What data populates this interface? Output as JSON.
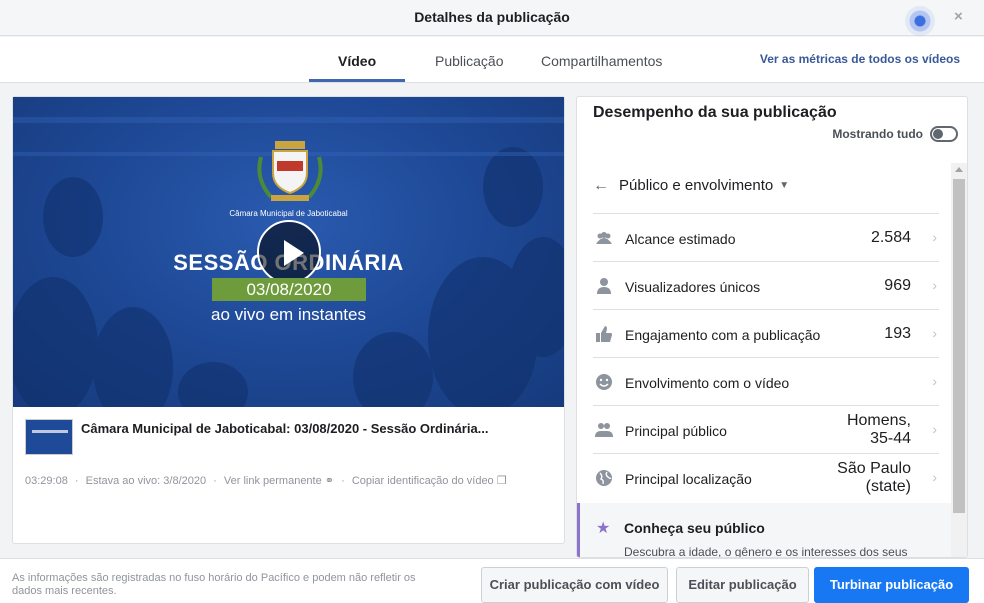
{
  "dialog": {
    "title": "Detalhes da publicação",
    "close_symbol": "×"
  },
  "tabs": [
    {
      "label": "Vídeo",
      "active": true
    },
    {
      "label": "Publicação",
      "active": false
    },
    {
      "label": "Compartilhamentos",
      "active": false
    }
  ],
  "metrics_link": "Ver as métricas de todos os vídeos",
  "video": {
    "overlay_org": "Câmara Municipal de Jaboticabal",
    "overlay_heading": "SESSÃO ORDINÁRIA",
    "overlay_date": "03/08/2020",
    "overlay_subtitle": "ao vivo em instantes",
    "title": "Câmara Municipal de Jaboticabal: 03/08/2020 - Sessão Ordinária...",
    "duration": "03:29:08",
    "live_label": "Estava ao vivo: 3/8/2020",
    "permalink_label": "Ver link permanente",
    "copy_id_label": "Copiar identificação do vídeo"
  },
  "performance": {
    "title": "Desempenho da sua publicação",
    "showing_label": "Mostrando tudo",
    "toggle_on": false,
    "section_label": "Público e envolvimento",
    "rows": [
      {
        "icon": "people-group-icon",
        "label": "Alcance estimado",
        "value": "2.584",
        "value_line2": ""
      },
      {
        "icon": "person-icon",
        "label": "Visualizadores únicos",
        "value": "969",
        "value_line2": ""
      },
      {
        "icon": "thumbs-up-icon",
        "label": "Engajamento com a publicação",
        "value": "193",
        "value_line2": ""
      },
      {
        "icon": "smiley-icon",
        "label": "Envolvimento com o vídeo",
        "value": "",
        "value_line2": ""
      },
      {
        "icon": "people-pair-icon",
        "label": "Principal público",
        "value": "Homens,",
        "value_line2": "35-44"
      },
      {
        "icon": "globe-icon",
        "label": "Principal localização",
        "value": "São Paulo",
        "value_line2": "(state)"
      }
    ],
    "know_title": "Conheça seu público",
    "know_desc": "Descubra a idade, o gênero e os interesses dos seus"
  },
  "footer": {
    "note": "As informações são registradas no fuso horário do Pacífico e podem não refletir os dados mais recentes.",
    "btn_create": "Criar publicação com vídeo",
    "btn_edit": "Editar publicação",
    "btn_boost": "Turbinar publicação"
  },
  "colors": {
    "accent": "#4267b2",
    "boost": "#1877f2",
    "video_bg": "#1f4a98",
    "date_band": "#6e9b3b",
    "insight": "#8c72cb"
  }
}
